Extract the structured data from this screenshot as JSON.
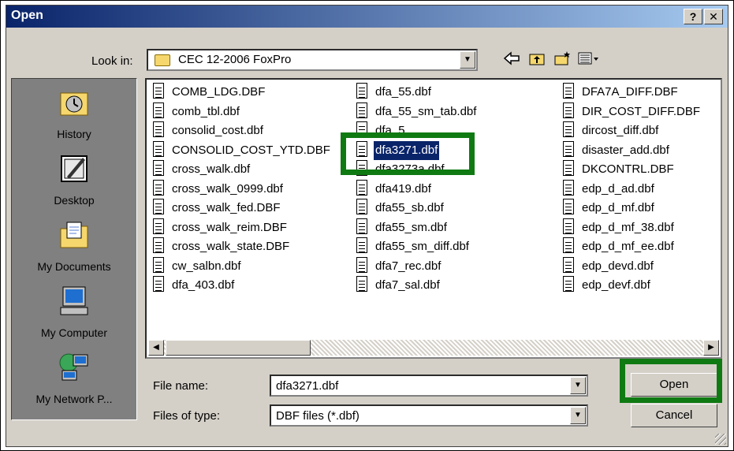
{
  "dialog": {
    "title": "Open",
    "help_label": "?",
    "close_label": "✕"
  },
  "lookin": {
    "label": "Look in:",
    "value": "CEC 12-2006 FoxPro"
  },
  "toolbar_icons": [
    "back-icon",
    "up-folder-icon",
    "new-folder-icon",
    "views-icon"
  ],
  "places": [
    {
      "label": "History",
      "icon": "history-icon"
    },
    {
      "label": "Desktop",
      "icon": "desktop-icon"
    },
    {
      "label": "My Documents",
      "icon": "my-documents-icon"
    },
    {
      "label": "My Computer",
      "icon": "my-computer-icon"
    },
    {
      "label": "My Network P...",
      "icon": "network-icon"
    }
  ],
  "files": {
    "col1": [
      "COMB_LDG.DBF",
      "comb_tbl.dbf",
      "consolid_cost.dbf",
      "CONSOLID_COST_YTD.DBF",
      "cross_walk.dbf",
      "cross_walk_0999.dbf",
      "cross_walk_fed.DBF",
      "cross_walk_reim.DBF",
      "cross_walk_state.DBF",
      "cw_salbn.dbf",
      "dfa_403.dbf"
    ],
    "col2": [
      "dfa_55.dbf",
      "dfa_55_sm_tab.dbf",
      "dfa_5",
      "dfa3271.dbf",
      "dfa3273a.dbf",
      "dfa419.dbf",
      "dfa55_sb.dbf",
      "dfa55_sm.dbf",
      "dfa55_sm_diff.dbf",
      "dfa7_rec.dbf",
      "dfa7_sal.dbf"
    ],
    "col3": [
      "DFA7A_DIFF.DBF",
      "DIR_COST_DIFF.DBF",
      "dircost_diff.dbf",
      "disaster_add.dbf",
      "DKCONTRL.DBF",
      "edp_d_ad.dbf",
      "edp_d_mf.dbf",
      "edp_d_mf_38.dbf",
      "edp_d_mf_ee.dbf",
      "edp_devd.dbf",
      "edp_devf.dbf"
    ]
  },
  "selected_file": "dfa3271.dbf",
  "filename": {
    "label": "File name:",
    "value": "dfa3271.dbf"
  },
  "filetype": {
    "label": "Files of type:",
    "value": "DBF files (*.dbf)"
  },
  "buttons": {
    "open": "Open",
    "cancel": "Cancel"
  },
  "colors": {
    "title_bar": "#0a246a",
    "selection": "#0a246a",
    "highlight_box": "#0f7a12",
    "dialog_bg": "#d4d0c8"
  }
}
